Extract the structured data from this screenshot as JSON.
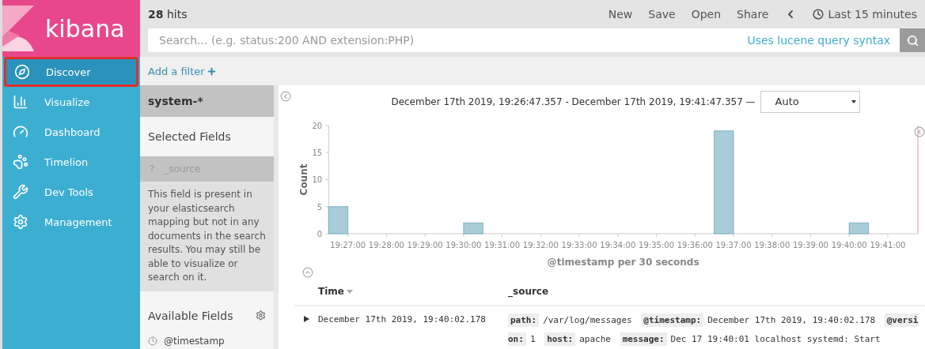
{
  "sidebar": {
    "logo": "kibana",
    "items": [
      {
        "label": "Discover",
        "selected": true,
        "highlighted": true
      },
      {
        "label": "Visualize",
        "selected": false,
        "highlighted": false
      },
      {
        "label": "Dashboard",
        "selected": false,
        "highlighted": false
      },
      {
        "label": "Timelion",
        "selected": false,
        "highlighted": false
      },
      {
        "label": "Dev Tools",
        "selected": false,
        "highlighted": false
      },
      {
        "label": "Management",
        "selected": false,
        "highlighted": false
      }
    ]
  },
  "topbar": {
    "hits_count": "28",
    "hits_label": "hits",
    "menu": [
      "New",
      "Save",
      "Open",
      "Share"
    ],
    "time_range": "Last 15 minutes"
  },
  "search": {
    "placeholder": "Search... (e.g. status:200 AND extension:PHP)",
    "syntax_link": "Uses lucene query syntax"
  },
  "filter": {
    "add_label": "Add a filter"
  },
  "fields_panel": {
    "index_pattern": "system-*",
    "selected_title": "Selected Fields",
    "selected_fields": [
      {
        "type_glyph": "?",
        "name": "_source",
        "disabled": true
      }
    ],
    "hint": "This field is present in your elasticsearch mapping but not in any documents in the search results. You may still be able to visualize or search on it.",
    "available_title": "Available Fields",
    "available_fields": [
      {
        "name": "@timestamp"
      }
    ]
  },
  "chart": {
    "range_text": "December 17th 2019, 19:26:47.357 - December 17th 2019, 19:41:47.357 —",
    "interval": "Auto",
    "chart_data": {
      "type": "bar",
      "xlabel": "@timestamp per 30 seconds",
      "ylabel": "Count",
      "categories": [
        null,
        "19:27:00",
        null,
        "19:28:00",
        null,
        "19:29:00",
        null,
        "19:30:00",
        null,
        "19:31:00",
        null,
        "19:32:00",
        null,
        "19:33:00",
        null,
        "19:34:00",
        null,
        "19:35:00",
        null,
        "19:36:00",
        null,
        "19:37:00",
        null,
        "19:38:00",
        null,
        "19:39:00",
        null,
        "19:40:00",
        null,
        "19:41:00",
        null
      ],
      "values": [
        5,
        0,
        0,
        0,
        0,
        0,
        0,
        2,
        0,
        0,
        0,
        0,
        0,
        0,
        0,
        0,
        0,
        0,
        0,
        0,
        19,
        0,
        0,
        0,
        0,
        0,
        0,
        2,
        0,
        0,
        0
      ],
      "ylim": [
        0,
        20
      ],
      "yticks": [
        0,
        5,
        10,
        15,
        20
      ]
    }
  },
  "table": {
    "columns": [
      "Time",
      "_source"
    ],
    "rows": [
      {
        "expanded": false,
        "time": "December 17th 2019, 19:40:02.178",
        "source": [
          {
            "key": "path:",
            "value": "/var/log/messages"
          },
          {
            "key": "@timestamp:",
            "value": "December 17th 2019, 19:40:02.178"
          },
          {
            "key": "@version:",
            "value": "1"
          },
          {
            "key": "host:",
            "value": "apache"
          },
          {
            "key": "message:",
            "value": "Dec 17 19:40:01 localhost systemd: Start"
          }
        ]
      }
    ]
  }
}
